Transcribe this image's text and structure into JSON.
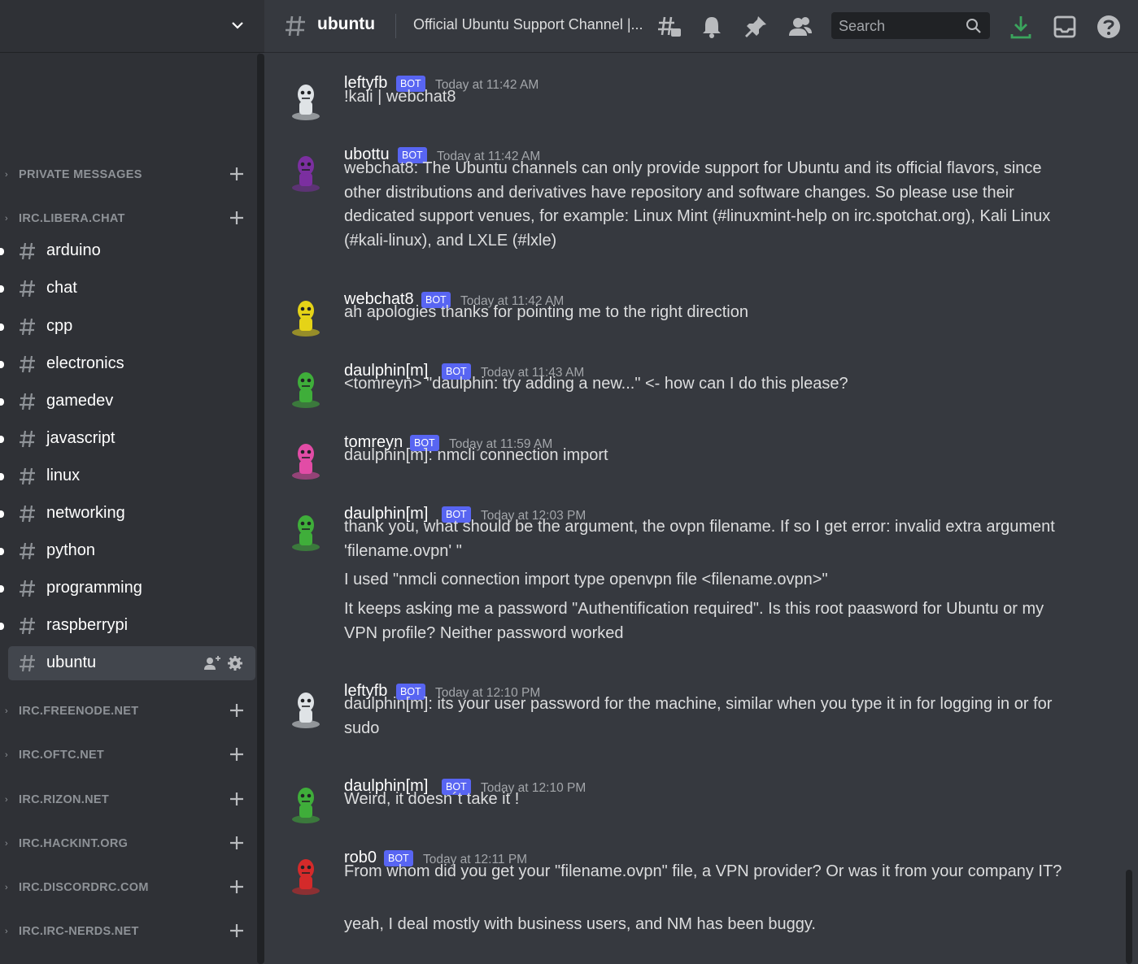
{
  "sidebar": {
    "categories": {
      "private_messages": "PRIVATE MESSAGES",
      "libera": "IRC.LIBERA.CHAT",
      "freenode": "IRC.FREENODE.NET",
      "oftc": "IRC.OFTC.NET",
      "rizon": "IRC.RIZON.NET",
      "hackint": "IRC.HACKINT.ORG",
      "discordrc": "IRC.DISCORDRC.COM",
      "ircnerds": "IRC.IRC-NERDS.NET"
    },
    "channels": [
      "arduino",
      "chat",
      "cpp",
      "electronics",
      "gamedev",
      "javascript",
      "linux",
      "networking",
      "python",
      "programming",
      "raspberrypi",
      "ubuntu"
    ],
    "active_channel": "ubuntu"
  },
  "header": {
    "channel_name": "ubuntu",
    "topic": "Official Ubuntu Support Channel |...",
    "search_placeholder": "Search"
  },
  "messages": [
    {
      "user": "leftyfb",
      "badge": "BOT",
      "time": "Today at 11:42 AM",
      "lines": [
        "!kali | webchat8"
      ],
      "avatar_color": "#dfe3e6"
    },
    {
      "user": "ubottu",
      "badge": "BOT",
      "time": "Today at 11:42 AM",
      "lines": [
        "webchat8: The Ubuntu channels can only provide support for Ubuntu and its official flavors, since other distributions and derivatives have repository and software changes. So please use their dedicated support venues, for example: Linux Mint (#linuxmint-help on irc.spotchat.org), Kali Linux (#kali-linux), and LXLE (#lxle)"
      ],
      "avatar_color": "#7b2fa0"
    },
    {
      "user": "webchat8",
      "badge": "BOT",
      "time": "Today at 11:42 AM",
      "lines": [
        "ah apologies thanks for pointing me to the right direction"
      ],
      "avatar_color": "#e5d317"
    },
    {
      "user": "daulphin[m]",
      "badge": "BOT",
      "time": "Today at 11:43 AM",
      "lines": [
        "<tomreyn> \"daulphin: try adding a new...\" <- how can I do this please?"
      ],
      "avatar_color": "#3fae3a"
    },
    {
      "user": "tomreyn",
      "badge": "BOT",
      "time": "Today at 11:59 AM",
      "lines": [
        "daulphin[m]: nmcli connection import"
      ],
      "avatar_color": "#e24ca6"
    },
    {
      "user": "daulphin[m]",
      "badge": "BOT",
      "time": "Today at 12:03 PM",
      "lines": [
        "thank you, what should be the argument, the ovpn filename. If so I get error: invalid extra argument 'filename.ovpn' \"",
        "I used \"nmcli connection import type openvpn file <filename.ovpn>\"",
        "It keeps asking me a password \"Authentification required\". Is this root paasword for Ubuntu or my VPN profile? Neither password worked"
      ],
      "avatar_color": "#3fae3a"
    },
    {
      "user": "leftyfb",
      "badge": "BOT",
      "time": "Today at 12:10 PM",
      "lines": [
        "daulphin[m]: its your user password for the machine, similar when you type it in for logging in or for sudo"
      ],
      "avatar_color": "#dfe3e6"
    },
    {
      "user": "daulphin[m]",
      "badge": "BOT",
      "time": "Today at 12:10 PM",
      "lines": [
        "Weird, it doesn´t take it !"
      ],
      "avatar_color": "#3fae3a"
    },
    {
      "user": "rob0",
      "badge": "BOT",
      "time": "Today at 12:11 PM",
      "lines": [
        "From whom did you get your \"filename.ovpn\" file, a VPN provider?  Or was it from your company IT?",
        "yeah, I deal mostly with business users, and NM has been buggy."
      ],
      "avatar_color": "#d42a2a"
    }
  ],
  "icons": {
    "header": [
      "hash-icon",
      "threads-icon",
      "bell-icon",
      "pin-icon",
      "members-icon",
      "search-icon",
      "download-icon",
      "inbox-icon",
      "help-icon"
    ],
    "sidebar": [
      "chevron-down-icon",
      "add-icon",
      "add-user-icon",
      "gear-icon"
    ]
  },
  "colors": {
    "badge": "#5865f2",
    "download": "#3ba55d",
    "background": "#36393f",
    "sidebar": "#2f3136"
  }
}
